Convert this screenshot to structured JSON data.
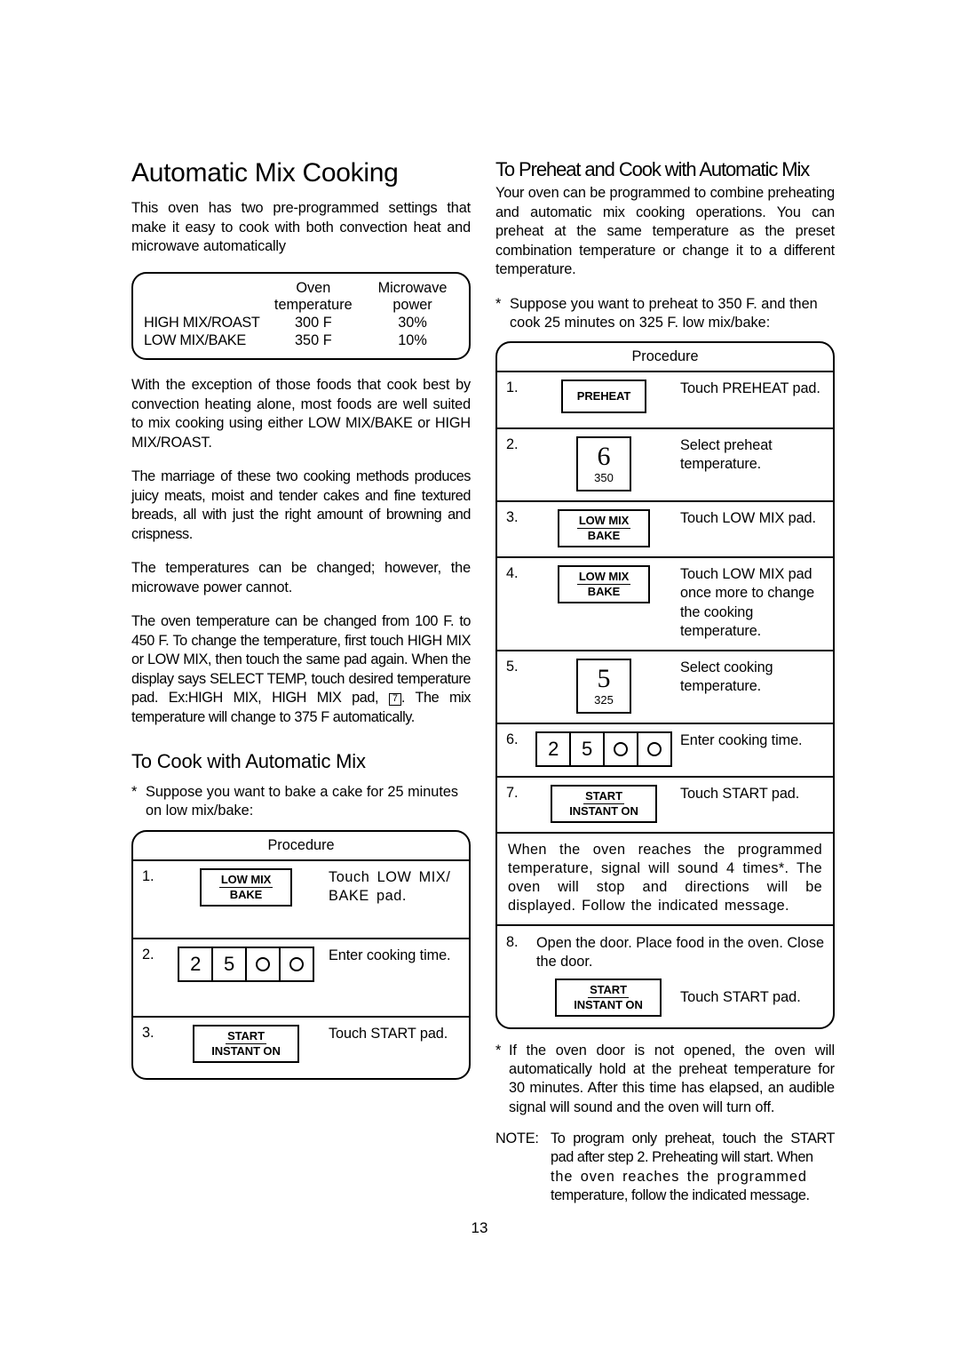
{
  "page": {
    "number": "13"
  },
  "left_column": {
    "title": "Automatic Mix Cooking",
    "intro": "This oven has two pre-programmed settings that make it easy to cook with both convection heat and microwave automatically",
    "spec_box": {
      "header_col1_line1": "Oven",
      "header_col1_line2": "temperature",
      "header_col2_line1": "Microwave",
      "header_col2_line2": "power",
      "rows": [
        {
          "label": "HIGH MIX/ROAST",
          "temperature": "300  F",
          "power": "30%"
        },
        {
          "label": "LOW MIX/BAKE",
          "temperature": "350  F",
          "power": "10%"
        }
      ]
    },
    "para_1": "With the exception of those foods that cook best by convection heating alone, most foods are well suited to mix cooking using either LOW MIX/BAKE or HIGH MIX/ROAST.",
    "para_2": "The marriage of these two cooking methods produces juicy meats, moist and tender cakes and fine textured breads, all with just the right amount of browning and crispness.",
    "para_3": "The temperatures can be changed; however, the microwave power cannot.",
    "para_4_a": "The oven temperature can be changed from 100  F. to 450  F. To change the temperature, first touch HIGH MIX or LOW MIX, then touch the same pad again. When the display says SELECT TEMP, touch desired temperature pad. Ex:HIGH MIX, HIGH MIX pad, ",
    "para_4_key": "7",
    "para_4_b": ". The mix temperature will change to 375  F automatically.",
    "section_title": "To Cook with Automatic Mix",
    "example_mark": "*",
    "example_text": "Suppose you want to bake a cake for 25 minutes on low mix/bake:",
    "procedure_header": "Procedure",
    "steps": [
      {
        "number": "1.",
        "pad_line1": "LOW MIX",
        "pad_line2": "BAKE",
        "text": "Touch LOW MIX/ BAKE pad."
      },
      {
        "number": "2.",
        "keys": [
          "2",
          "5",
          "zero-circle",
          "zero-circle"
        ],
        "text": "Enter cooking time."
      },
      {
        "number": "3.",
        "pad_line1": "START",
        "pad_line2": "INSTANT ON",
        "text": "Touch START pad."
      }
    ]
  },
  "right_column": {
    "title": "To Preheat and Cook with Automatic Mix",
    "intro": "Your oven can be programmed to combine preheating and automatic mix cooking operations. You can preheat at the same temperature as the preset combination temperature or change it to a different temperature.",
    "example_mark": "*",
    "example_text": "Suppose you want to preheat to 350  F. and then cook 25 minutes on 325  F. low mix/bake:",
    "procedure_header": "Procedure",
    "steps": [
      {
        "number": "1.",
        "pad_single": "PREHEAT",
        "text": "Touch PREHEAT pad."
      },
      {
        "number": "2.",
        "temp_big": "6",
        "temp_small": "350",
        "text": "Select preheat temperature."
      },
      {
        "number": "3.",
        "pad_line1": "LOW MIX",
        "pad_line2": "BAKE",
        "text": "Touch LOW MIX pad."
      },
      {
        "number": "4.",
        "pad_line1": "LOW MIX",
        "pad_line2": "BAKE",
        "text": "Touch LOW MIX pad once more to change the cooking temperature."
      },
      {
        "number": "5.",
        "temp_big": "5",
        "temp_small": "325",
        "text": "Select cooking temperature."
      },
      {
        "number": "6.",
        "keys": [
          "2",
          "5",
          "zero-circle",
          "zero-circle"
        ],
        "text": "Enter cooking time."
      },
      {
        "number": "7.",
        "pad_line1": "START",
        "pad_line2": "INSTANT ON",
        "text": "Touch START pad."
      }
    ],
    "signal_note": "When the oven reaches the programmed temperature, signal will sound 4 times*. The oven will stop and directions will be displayed. Follow the indicated message.",
    "step8": {
      "number": "8.",
      "text": "Open the door. Place food in the oven. Close the door.",
      "pad_line1": "START",
      "pad_line2": "INSTANT ON",
      "pad_text": "Touch START pad."
    },
    "footnote_mark": "*",
    "footnote_text": "If the oven door is not opened, the oven will automatically hold at the preheat temperature for 30 minutes. After this time has elapsed, an audible signal will sound and the oven will turn off.",
    "note_label": "NOTE:",
    "note_text_a": "To program only preheat, touch the START pad after step 2. Preheating will start. When ",
    "note_text_wide": "the oven reaches the programmed",
    "note_text_b": "temperature, follow the indicated message."
  }
}
